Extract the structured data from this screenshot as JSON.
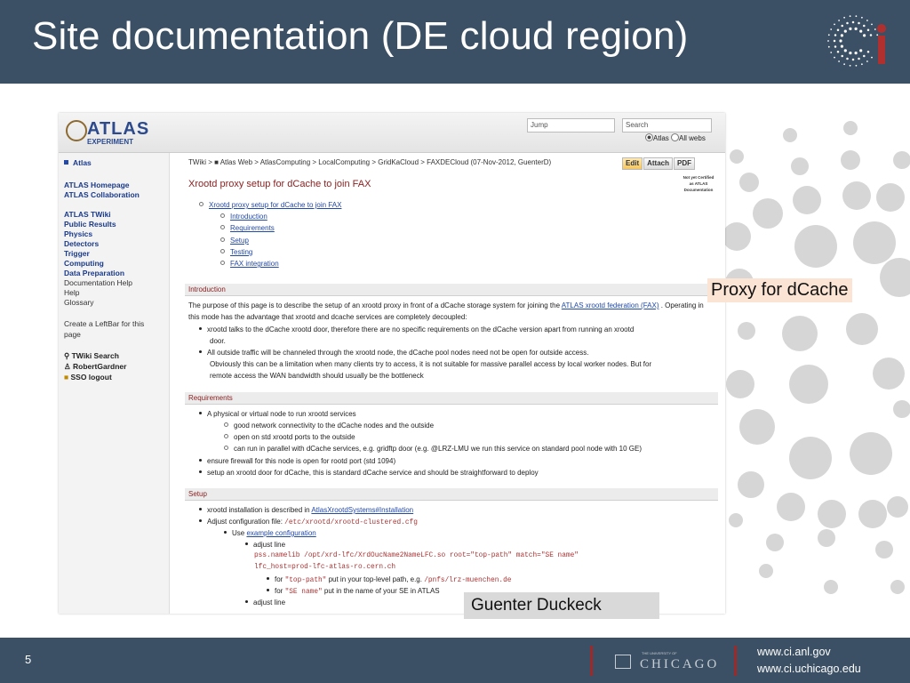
{
  "slide": {
    "title": "Site documentation (DE cloud region)",
    "number": "5",
    "footer_urls": [
      "www.ci.anl.gov",
      "www.ci.uchicago.edu"
    ],
    "uc_logo_tagline": "THE UNIVERSITY OF",
    "uc_logo_name": "CHICAGO",
    "callout_proxy": "Proxy for dCache",
    "callout_author": "Guenter Duckeck",
    "colors": {
      "header_bg": "#3b5064",
      "accent_red": "#9c2a2a",
      "callout_bg": "#fbe4d4",
      "circle_gray": "#d6d6d6"
    }
  },
  "atlas": {
    "logo_top": "ATLAS",
    "logo_bottom": "EXPERIMENT",
    "jump_placeholder": "Jump",
    "search_placeholder": "Search",
    "radio_atlas": "Atlas",
    "radio_all": "All webs",
    "left_bar": {
      "web_name": "Atlas",
      "links1": [
        "ATLAS Homepage",
        "ATLAS Collaboration"
      ],
      "links2": [
        "ATLAS TWiki",
        "Public Results",
        "Physics",
        "Detectors",
        "Trigger",
        "Computing",
        "Data Preparation"
      ],
      "links3": [
        "Documentation Help",
        "Help",
        "Glossary"
      ],
      "create_leftbar": "Create a LeftBar for this page",
      "tools": [
        "TWiki Search",
        "RobertGardner",
        "SSO logout"
      ]
    },
    "breadcrumb": "TWiki > ■ Atlas Web > AtlasComputing > LocalComputing > GridKaCloud > FAXDECloud (07-Nov-2012, GuenterD)",
    "buttons": [
      "Edit",
      "Attach",
      "PDF"
    ],
    "cert_text": "Not yet Certified as ATLAS Documentation",
    "page_title": "Xrootd proxy setup for dCache to join FAX",
    "toc_main": "Xrootd proxy setup for dCache to join FAX",
    "toc_items": [
      "Introduction",
      "Requirements",
      "Setup",
      "Testing",
      "FAX integration"
    ],
    "intro_head": "Introduction",
    "intro_text_1": "The purpose of this page is to describe the setup of an xrootd proxy in front of a dCache storage system for joining the ",
    "intro_link": "ATLAS xrootd federation (FAX)",
    "intro_text_2": " . Operating in this mode has the advantage that xrootd and dcache services are completely decoupled:",
    "intro_b1_l1": "xrootd talks to the dCache xrootd door, therefore there are no specific requirements on the dCache version apart from running an xrootd",
    "intro_b1_l2": "door.",
    "intro_b2_l1": "All outside traffic will be channeled through the xrootd node, the dCache pool nodes need not be open for outside access.",
    "intro_b2_l2": "Obviously this can be a limitation when many clients try to access, it is not suitable for massive parallel access by local worker nodes. But for",
    "intro_b2_l3": "remote access the WAN bandwidth should usually be the bottleneck",
    "req_head": "Requirements",
    "req_b1": "A physical or virtual node to run xrootd services",
    "req_s1": "good network connectivity to the dCache nodes and the outside",
    "req_s2": "open on std xrootd ports to the outside",
    "req_s3": "can run in parallel with dCache services, e.g. gridftp door (e.g. @LRZ-LMU we run this service on standard pool node with 10 GE)",
    "req_b2": "ensure firewall for this node is open for rootd port (std 1094)",
    "req_b3": "setup an xrootd door for dCache, this is standard dCache service and should be straightforward to deploy",
    "setup_head": "Setup",
    "setup_b1_a": "xrootd installation is described in ",
    "setup_b1_link": "AtlasXrootdSystems#Installation",
    "setup_b2_a": "Adjust configuration file: ",
    "setup_b2_code": "/etc/xrootd/xrootd-clustered.cfg",
    "setup_use": "Use ",
    "setup_use_link": "example configuration",
    "adjust_line": "adjust line",
    "code_line_1": "pss.namelib /opt/xrd-lfc/XrdOucName2NameLFC.so root=\"top-path\" match=\"SE name\"",
    "code_line_2": "lfc_host=prod-lfc-atlas-ro.cern.ch",
    "for1_a": "for ",
    "for1_code": "\"top-path\"",
    "for1_b": " put in your top-level path, e.g. ",
    "for1_code2": "/pnfs/lrz-muenchen.de",
    "for2_a": "for ",
    "for2_code": "\"SE name\"",
    "for2_b": " put in the name of your SE in ATLAS",
    "adjust_line_2": "adjust line"
  }
}
